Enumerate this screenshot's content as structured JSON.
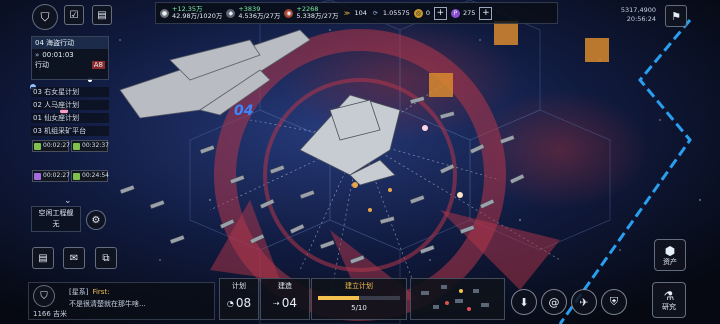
{
  "top_left": {
    "coords": "5317,4900"
  },
  "top_right": {
    "coords_line1": "5317,4900",
    "coords_line2": "20:56:24"
  },
  "resources": [
    {
      "name": "metal",
      "delta": "+12.35万",
      "amount": "42.98万/1020万",
      "color": "#c9c9c9"
    },
    {
      "name": "crystal",
      "delta": "+3839",
      "amount": "4.536万/27万",
      "color": "#d0d0d0"
    },
    {
      "name": "deuterium",
      "delta": "+2268",
      "amount": "5.338万/27万",
      "color": "#e07a5f"
    }
  ],
  "currencies": [
    {
      "name": "rank",
      "value": "104",
      "color": "#e2b441"
    },
    {
      "name": "fleet-power",
      "value": "1.05575",
      "color": "#8fb7e6"
    },
    {
      "name": "gold",
      "value": "0",
      "color": "#f2c14e"
    },
    {
      "name": "purple-gem",
      "value": "275",
      "color": "#a46be0"
    }
  ],
  "left_panel": {
    "header": "04 海盗行动",
    "timer": "00:01:03",
    "action": "行动",
    "action_value": "A8",
    "tasks": [
      "03 右女星计划",
      "02 人马座计划",
      "01 仙女座计划",
      "03 机组采矿平台"
    ],
    "slots": [
      "00:02:27",
      "00:32:37",
      "00:02:27",
      "00:24:54"
    ],
    "idle_label": "空闲工程舰",
    "idle_value": "无"
  },
  "map_label": "04",
  "chat": {
    "channel": "[星系]",
    "author": "First:",
    "message": "不是很清楚就在那牛啥...",
    "player_id": "1166 吉米"
  },
  "plan_panel": {
    "plan_label": "计划",
    "plan_value": "08",
    "build_label": "建造",
    "build_value": "04",
    "establish_label": "建立计划",
    "progress": "5/10"
  },
  "right_buttons": {
    "assets": "资产",
    "research": "研究"
  }
}
